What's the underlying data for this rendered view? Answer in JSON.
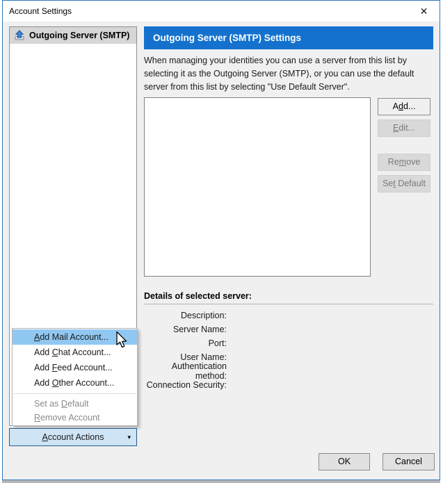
{
  "window": {
    "title": "Account Settings"
  },
  "icons": {
    "close": "✕",
    "dropdown_caret": "▾",
    "smtp_server": "tray-with-blue-up-arrow"
  },
  "sidebar": {
    "items": [
      {
        "label": "Outgoing Server (SMTP)",
        "selected": true,
        "icon": "smtp-server-icon"
      }
    ],
    "account_actions": {
      "label": "Account Actions",
      "mnemonic": "A"
    }
  },
  "menu": {
    "items": [
      {
        "label": "Add Mail Account...",
        "mnemonic": "A",
        "state": "highlighted"
      },
      {
        "label": "Add Chat Account...",
        "mnemonic": "C",
        "state": "enabled"
      },
      {
        "label": "Add Feed Account...",
        "mnemonic": "F",
        "state": "enabled"
      },
      {
        "label": "Add Other Account...",
        "mnemonic": "O",
        "state": "enabled"
      },
      {
        "label": "Set as Default",
        "mnemonic": "D",
        "state": "disabled"
      },
      {
        "label": "Remove Account",
        "mnemonic": "R",
        "state": "disabled"
      }
    ]
  },
  "main": {
    "heading": "Outgoing Server (SMTP) Settings",
    "description": "When managing your identities you can use a server from this list by selecting it as the Outgoing Server (SMTP), or you can use the default server from this list by selecting \"Use Default Server\".",
    "server_list": {
      "items": []
    },
    "buttons": [
      {
        "label": "Add...",
        "mnemonic": "d",
        "enabled": true
      },
      {
        "label": "Edit...",
        "mnemonic": "E",
        "enabled": false
      },
      {
        "label": "Remove",
        "mnemonic": "m",
        "enabled": false
      },
      {
        "label": "Set Default",
        "mnemonic": "t",
        "enabled": false
      }
    ],
    "details": {
      "heading": "Details of selected server:",
      "rows": [
        {
          "label": "Description:",
          "value": ""
        },
        {
          "label": "Server Name:",
          "value": ""
        },
        {
          "label": "Port:",
          "value": ""
        },
        {
          "label": "User Name:",
          "value": ""
        },
        {
          "label": "Authentication method:",
          "value": ""
        },
        {
          "label": "Connection Security:",
          "value": ""
        }
      ]
    }
  },
  "footer": {
    "ok_label": "OK",
    "cancel_label": "Cancel"
  },
  "colors": {
    "accent_banner": "#1472ce",
    "window_border": "#2e79bd",
    "menu_highlight": "#91c8f2",
    "account_actions_bg": "#cfe4f5",
    "account_actions_border": "#25598c",
    "selected_item_bg": "#d6d6d6",
    "disabled_text": "#8a8a8a",
    "dialog_bg": "#f0f0f0"
  }
}
